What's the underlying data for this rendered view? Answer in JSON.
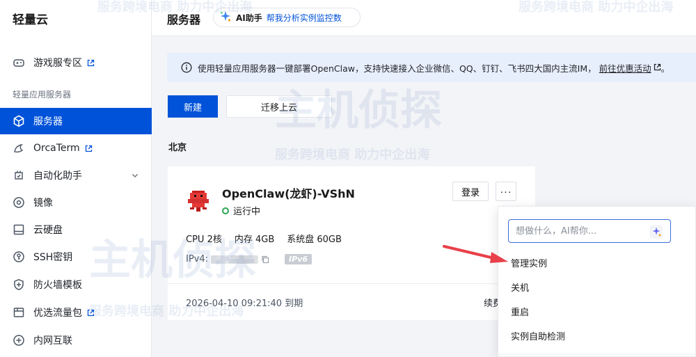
{
  "app": {
    "brand": "轻量云"
  },
  "sidebar": {
    "section_label": "轻量应用服务器",
    "items": [
      {
        "label": "游戏服专区",
        "icon": "gamepad-icon",
        "external": true
      },
      {
        "label": "服务器",
        "icon": "cube-icon",
        "active": true
      },
      {
        "label": "OrcaTerm",
        "icon": "terminal-icon",
        "external": true
      },
      {
        "label": "自动化助手",
        "icon": "automation-icon",
        "expandable": true
      },
      {
        "label": "镜像",
        "icon": "disc-icon"
      },
      {
        "label": "云硬盘",
        "icon": "disk-icon"
      },
      {
        "label": "SSH密钥",
        "icon": "key-icon"
      },
      {
        "label": "防火墙模板",
        "icon": "shield-icon"
      },
      {
        "label": "优选流量包",
        "icon": "traffic-package-icon",
        "external": true
      },
      {
        "label": "内网互联",
        "icon": "network-icon"
      }
    ]
  },
  "header": {
    "title": "服务器",
    "ai_assistant": {
      "name": "AI助手",
      "hint": "帮我分析实例监控数"
    }
  },
  "banner": {
    "text": "使用轻量应用服务器一键部署OpenClaw，支持快速接入企业微信、QQ、钉钉、飞书四大国内主流IM，",
    "link_text": "前往优惠活动",
    "suffix": "。"
  },
  "toolbar": {
    "new_label": "新建",
    "migrate_label": "迁移上云"
  },
  "region": "北京",
  "instance": {
    "name": "OpenClaw(龙虾)-VShN",
    "status": "运行中",
    "cpu": "CPU 2核",
    "memory": "内存 4GB",
    "system_disk": "系统盘 60GB",
    "ipv4_label": "IPv4:",
    "ipv6_badge": "IPv6",
    "expiry": "2026-04-10 09:21:40 到期",
    "renew_label": "续费",
    "login_label": "登录",
    "more_label": "···"
  },
  "dropdown": {
    "ai_placeholder": "想做什么，AI帮你...",
    "items": [
      "管理实例",
      "关机",
      "重启",
      "实例自助检测"
    ]
  },
  "watermark": {
    "brand": "主机侦探",
    "slogan": "服务跨境电商 助力中企出海"
  },
  "colors": {
    "primary": "#0052d9",
    "running": "#29a654",
    "banner_bg": "#e8effc",
    "annotation_arrow": "#e8404a"
  }
}
